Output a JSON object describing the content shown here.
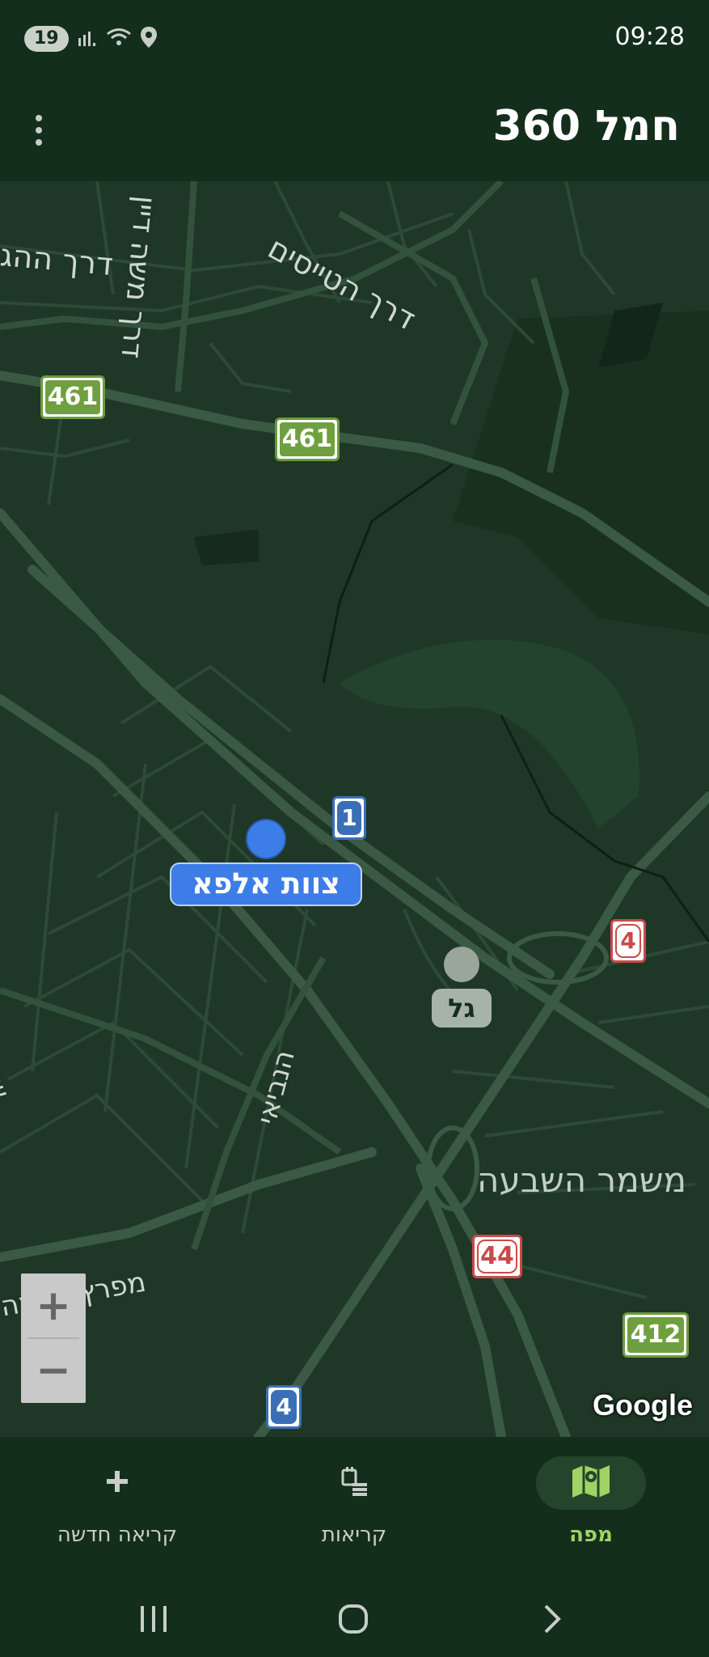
{
  "status_bar": {
    "notification_count": "19",
    "time": "09:28",
    "icons": [
      "signal-icon",
      "wifi-icon",
      "location-icon"
    ]
  },
  "app_bar": {
    "title": "חמל 360",
    "menu_icon": "more-vert-icon"
  },
  "map": {
    "street_labels": [
      {
        "id": "derech-hatayasim",
        "text": "דרך הטייסים"
      },
      {
        "id": "derech-moshe-dayan",
        "text": "דרך משה דיין"
      },
      {
        "id": "derech-hahagana",
        "text": "דרך ההג"
      },
      {
        "id": "hanevim",
        "text": "הנביאי"
      },
      {
        "id": "sderot",
        "text": "שדרו"
      },
      {
        "id": "mifratz-shlomo",
        "text": "מפרץ שלמה"
      }
    ],
    "area_label": "משמר השבעה",
    "road_shields": [
      {
        "id": "shield-461-a",
        "number": "461",
        "color": "green"
      },
      {
        "id": "shield-461-b",
        "number": "461",
        "color": "green"
      },
      {
        "id": "shield-1",
        "number": "1",
        "color": "blue"
      },
      {
        "id": "shield-4-red",
        "number": "4",
        "color": "red"
      },
      {
        "id": "shield-44",
        "number": "44",
        "color": "red"
      },
      {
        "id": "shield-412",
        "number": "412",
        "color": "green"
      },
      {
        "id": "shield-4-blue",
        "number": "4",
        "color": "blue"
      }
    ],
    "markers": [
      {
        "id": "team-alpha",
        "label": "צוות אלפא",
        "dot_color": "#3d7de8",
        "label_bg": "#3d7de8",
        "label_color": "#ffffff"
      },
      {
        "id": "gal",
        "label": "גל",
        "dot_color": "#9aa69a",
        "label_bg": "#a8b3a8",
        "label_color": "#142e1c"
      }
    ],
    "zoom_in": "+",
    "zoom_out": "−",
    "attribution": "Google"
  },
  "bottom_nav": {
    "items": [
      {
        "id": "new-call",
        "label": "קריאה חדשה",
        "icon": "plus-icon",
        "active": false
      },
      {
        "id": "calls",
        "label": "קריאות",
        "icon": "calls-list-icon",
        "active": false
      },
      {
        "id": "map",
        "label": "מפה",
        "icon": "map-icon",
        "active": true
      }
    ]
  },
  "system_nav": [
    "recents-icon",
    "home-icon",
    "back-icon"
  ],
  "colors": {
    "background": "#142e1c",
    "map_bg": "#1f3727",
    "road": "#3a5a43",
    "accent_green": "#9fd464",
    "marker_blue": "#3d7de8"
  }
}
